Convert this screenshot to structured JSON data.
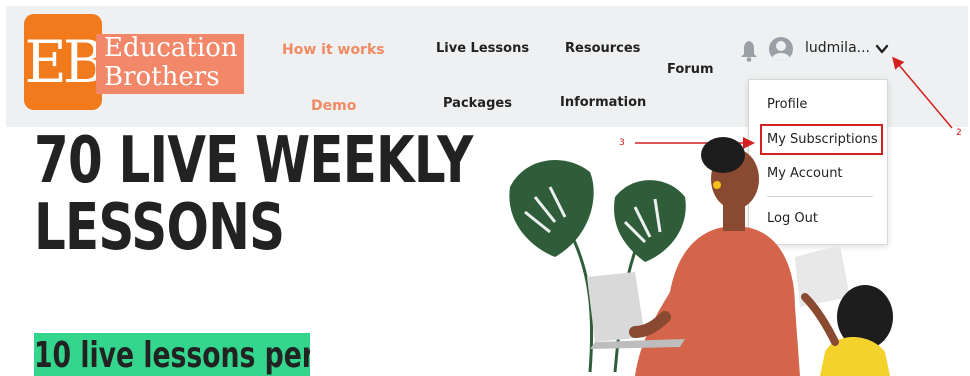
{
  "brand": {
    "logo_mark": "EB",
    "name_line1": "Education",
    "name_line2": "Brothers"
  },
  "nav": {
    "how_it_works": "How it works",
    "live_lessons": "Live Lessons",
    "resources": "Resources",
    "forum": "Forum",
    "demo": "Demo",
    "packages": "Packages",
    "information": "Information"
  },
  "user": {
    "name": "ludmila..."
  },
  "dropdown": {
    "items": [
      "Profile",
      "My Subscriptions",
      "My Account",
      "Log Out"
    ]
  },
  "annotations": {
    "step2": "2",
    "step3": "3"
  },
  "hero": {
    "title_line1": "70 LIVE WEEKLY",
    "title_line2": "LESSONS",
    "subtitle": "10 live lessons per"
  },
  "colors": {
    "brand_orange": "#f07a1c",
    "nav_accent": "#f08b63",
    "highlight_green": "#33d68c",
    "annotation_red": "#d32020"
  }
}
